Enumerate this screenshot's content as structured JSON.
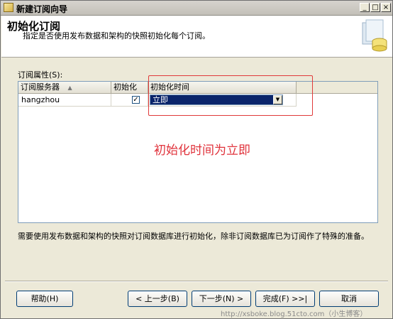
{
  "window": {
    "title": "新建订阅向导",
    "controls": [
      "minimize-icon",
      "maximize-icon",
      "close-icon"
    ]
  },
  "header": {
    "title": "初始化订阅",
    "subtitle": "指定是否使用发布数据和架构的快照初始化每个订阅。"
  },
  "properties": {
    "label": "订阅属性(S):",
    "columns": [
      "订阅服务器",
      "初始化",
      "初始化时间"
    ],
    "rows": [
      {
        "server": "hangzhou",
        "initialize": true,
        "init_time": "立即"
      }
    ]
  },
  "annotation": "初始化时间为立即",
  "note": "需要使用发布数据和架构的快照对订阅数据库进行初始化，除非订阅数据库已为订阅作了特殊的准备。",
  "buttons": {
    "help": "帮助(H)",
    "back": "< 上一步(B)",
    "next": "下一步(N) >",
    "finish": "完成(F) >>|",
    "cancel": "取消"
  },
  "watermark": "http://xsboke.blog.51cto.com（小生博客）",
  "colors": {
    "annotation": "#e0323b",
    "selection": "#0a246a",
    "dialog_bg": "#ece9d8"
  }
}
